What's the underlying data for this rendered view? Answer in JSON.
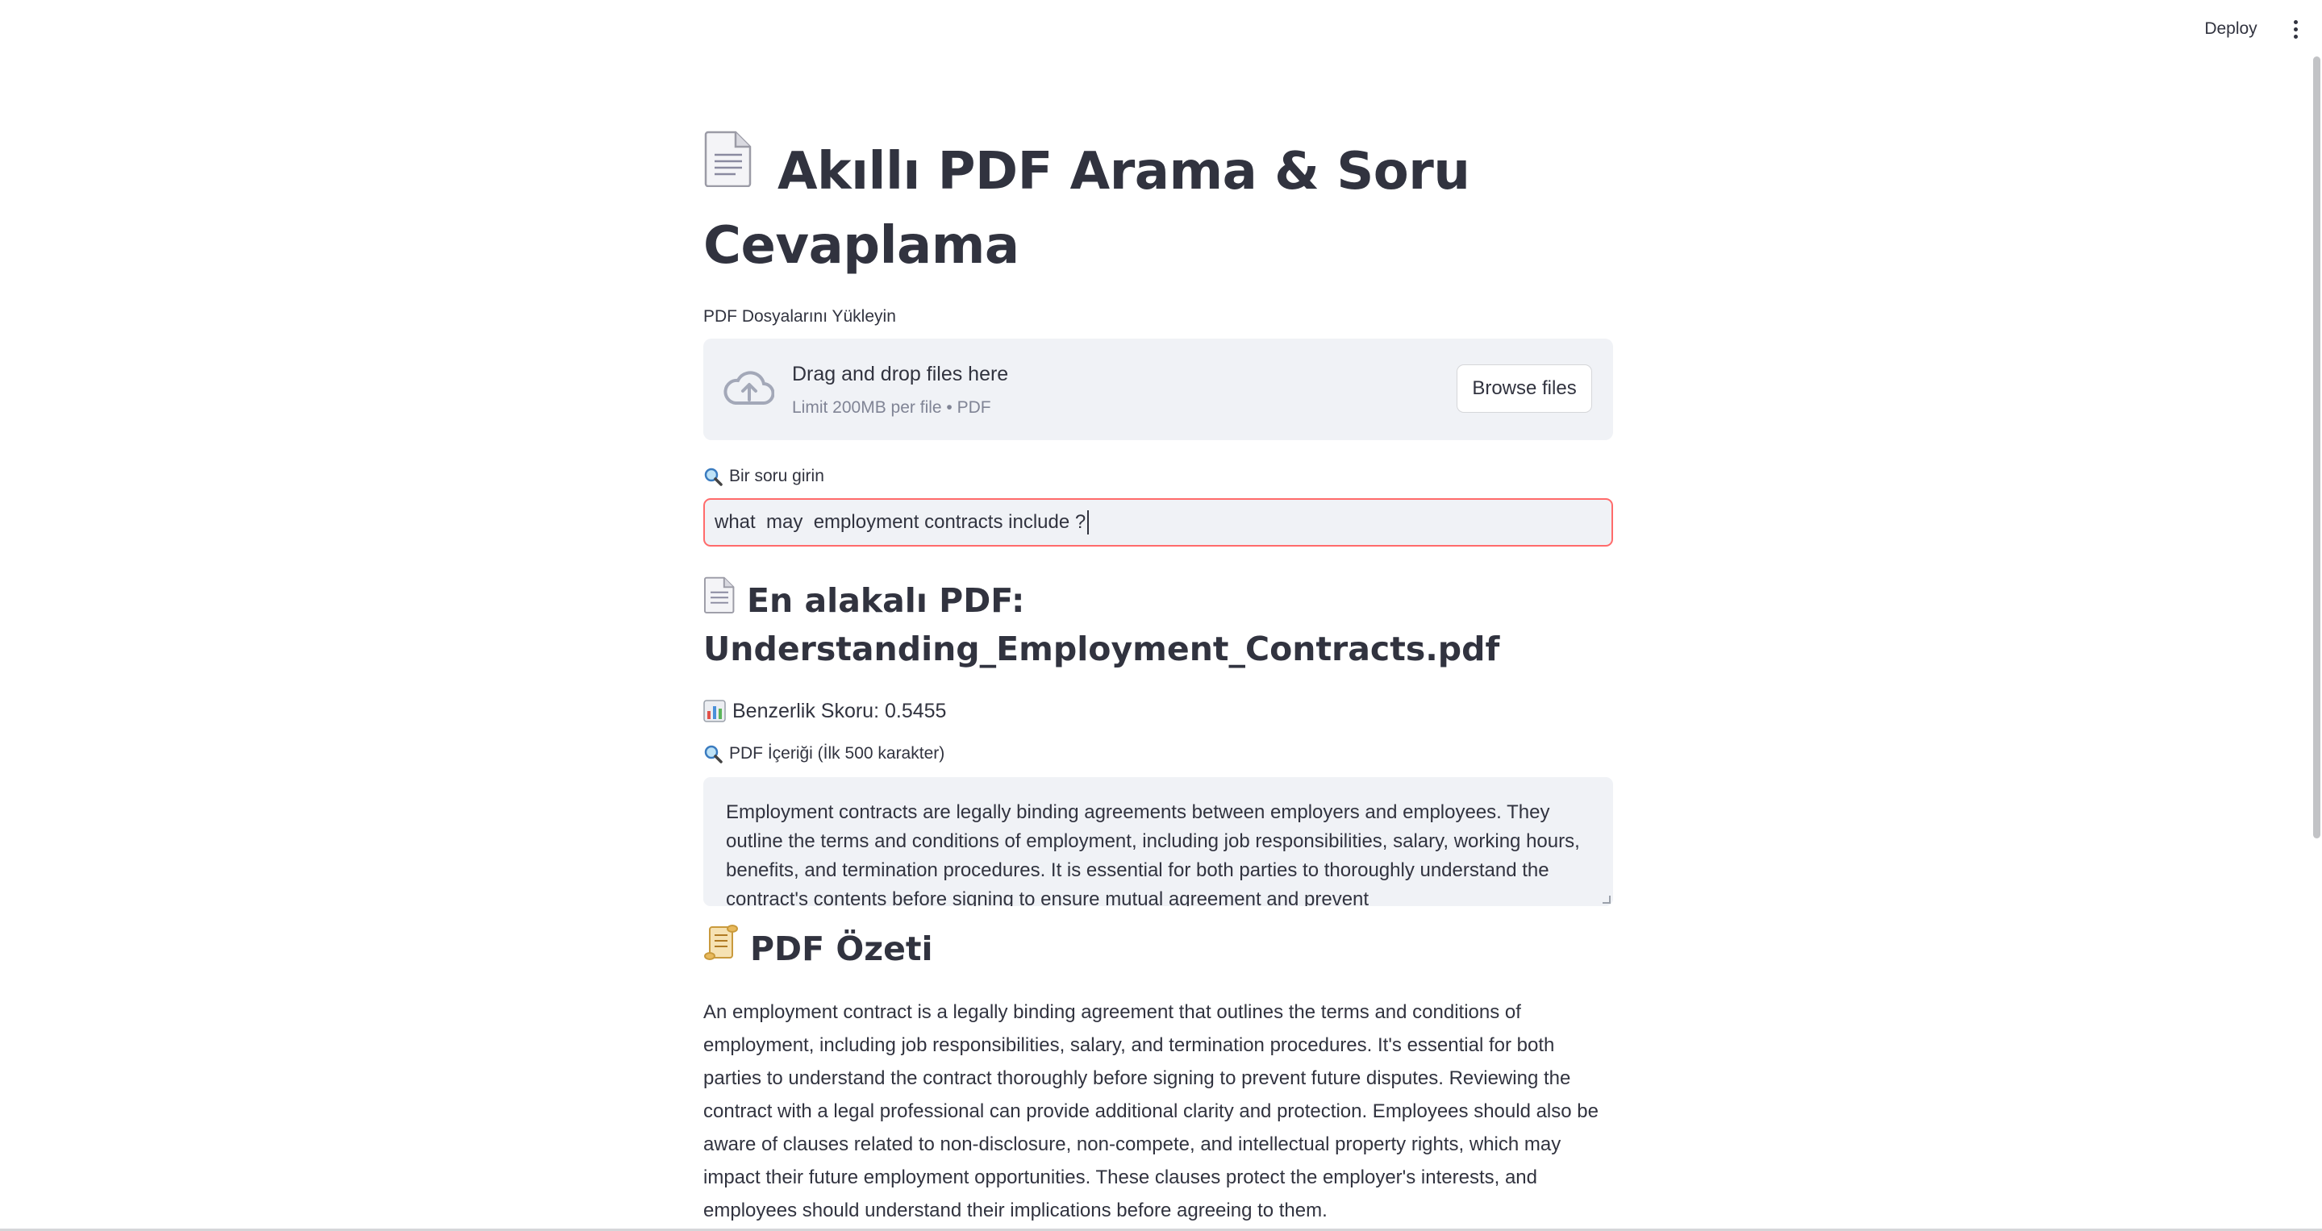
{
  "header": {
    "deploy_label": "Deploy",
    "menu_icon": "vertical-ellipsis-icon"
  },
  "page": {
    "title": "Akıllı PDF Arama & Soru Cevaplama",
    "title_icon": "page-facing-up-emoji"
  },
  "uploader": {
    "label": "PDF Dosyalarını Yükleyin",
    "drop_text": "Drag and drop files here",
    "limit_text": "Limit 200MB per file • PDF",
    "browse_label": "Browse files",
    "icon": "cloud-upload-icon"
  },
  "question": {
    "label": "Bir soru girin",
    "icon": "magnifier-emoji",
    "value": "what  may  employment contracts include ?"
  },
  "result": {
    "heading_line1": "En alakalı PDF:",
    "heading_line2": "Understanding_Employment_Contracts.pdf",
    "score_text": "Benzerlik Skoru: 0.5455",
    "score_icon": "bar-chart-emoji",
    "content_label": "PDF İçeriği (İlk 500 karakter)",
    "content_text": "Employment contracts are legally binding agreements between employers and employees. They outline the terms and conditions of employment, including job responsibilities, salary, working hours, benefits, and termination procedures. It is essential for both parties to thoroughly understand the contract's contents before signing to ensure mutual agreement and prevent"
  },
  "summary": {
    "heading": "PDF Özeti",
    "icon": "scroll-emoji",
    "text": "An employment contract is a legally binding agreement that outlines the terms and conditions of employment, including job responsibilities, salary, and termination procedures. It's essential for both parties to understand the contract thoroughly before signing to prevent future disputes. Reviewing the contract with a legal professional can provide additional clarity and protection. Employees should also be aware of clauses related to non-disclosure, non-compete, and intellectual property rights, which may impact their future employment opportunities. These clauses protect the employer's interests, and employees should understand their implications before agreeing to them."
  },
  "colors": {
    "input_border_focus": "#ff6b6b",
    "surface": "#f0f2f6",
    "text": "#31333f",
    "muted": "#808495"
  }
}
